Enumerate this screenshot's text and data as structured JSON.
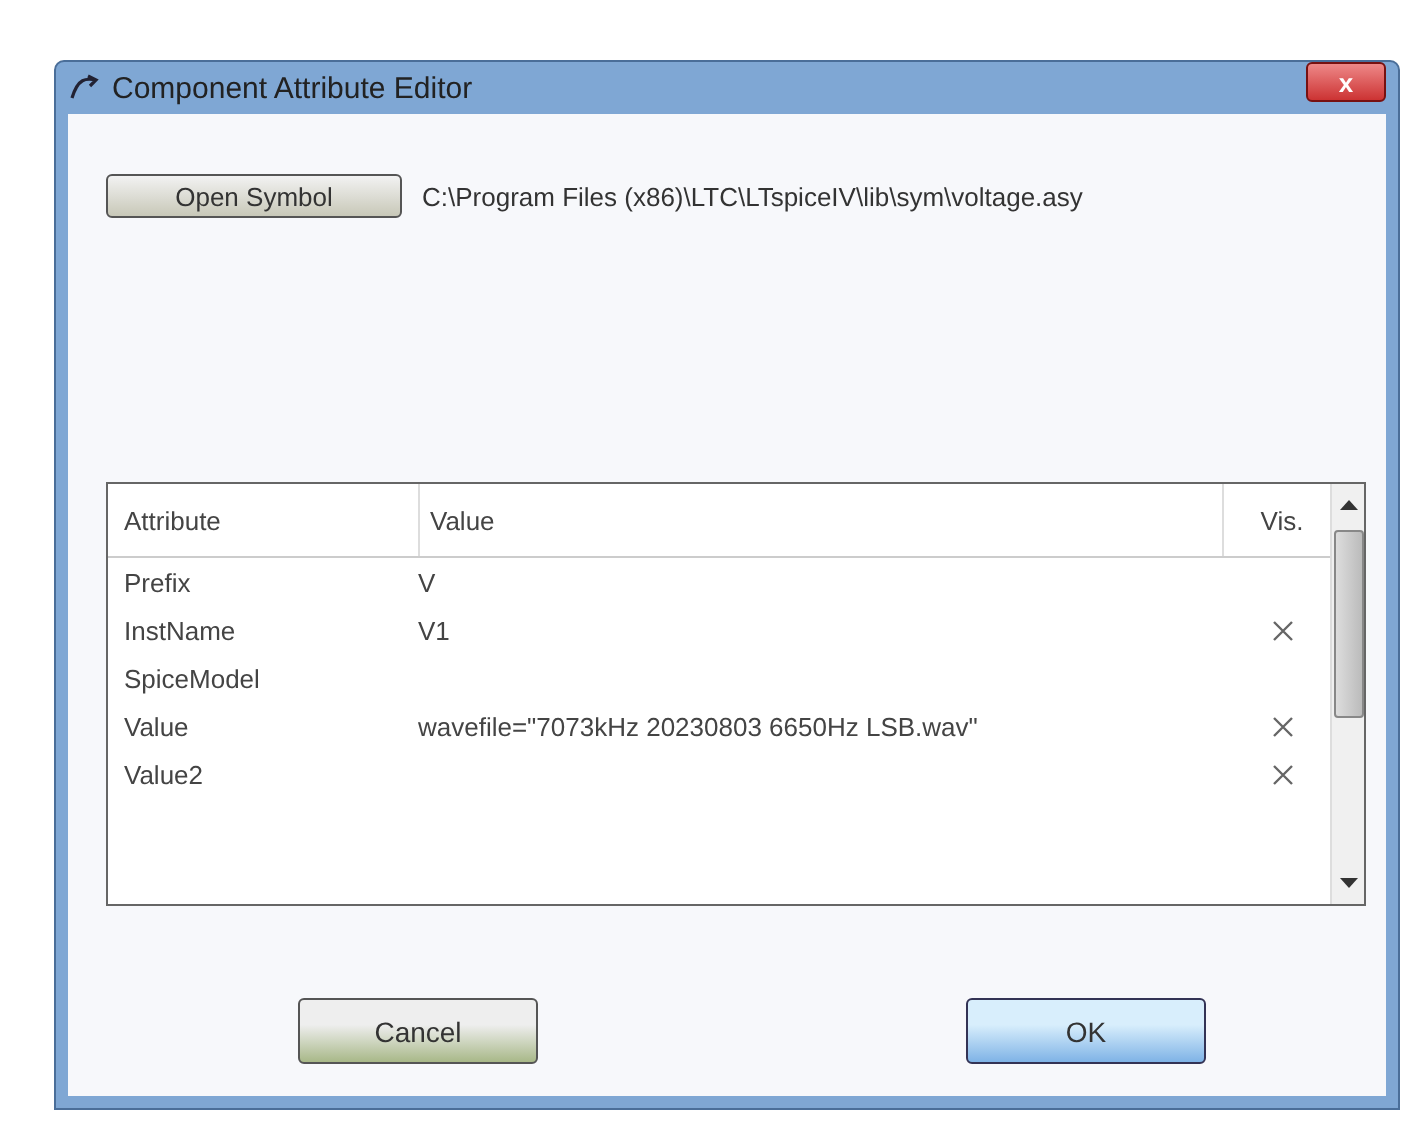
{
  "window": {
    "title": "Component Attribute Editor",
    "close_label": "x"
  },
  "symbol": {
    "button": "Open Symbol",
    "path": "C:\\Program Files (x86)\\LTC\\LTspiceIV\\lib\\sym\\voltage.asy"
  },
  "table": {
    "columns": [
      "Attribute",
      "Value",
      "Vis."
    ],
    "rows": [
      {
        "attribute": "Prefix",
        "value": "V",
        "visible": false
      },
      {
        "attribute": "InstName",
        "value": "V1",
        "visible": true
      },
      {
        "attribute": "SpiceModel",
        "value": "",
        "visible": false
      },
      {
        "attribute": "Value",
        "value": "wavefile=\"7073kHz 20230803 6650Hz LSB.wav\"",
        "visible": true
      },
      {
        "attribute": "Value2",
        "value": "",
        "visible": true
      }
    ]
  },
  "buttons": [
    {
      "label": "Cancel",
      "kind": "cancel"
    },
    {
      "label": "OK",
      "kind": "default"
    }
  ]
}
